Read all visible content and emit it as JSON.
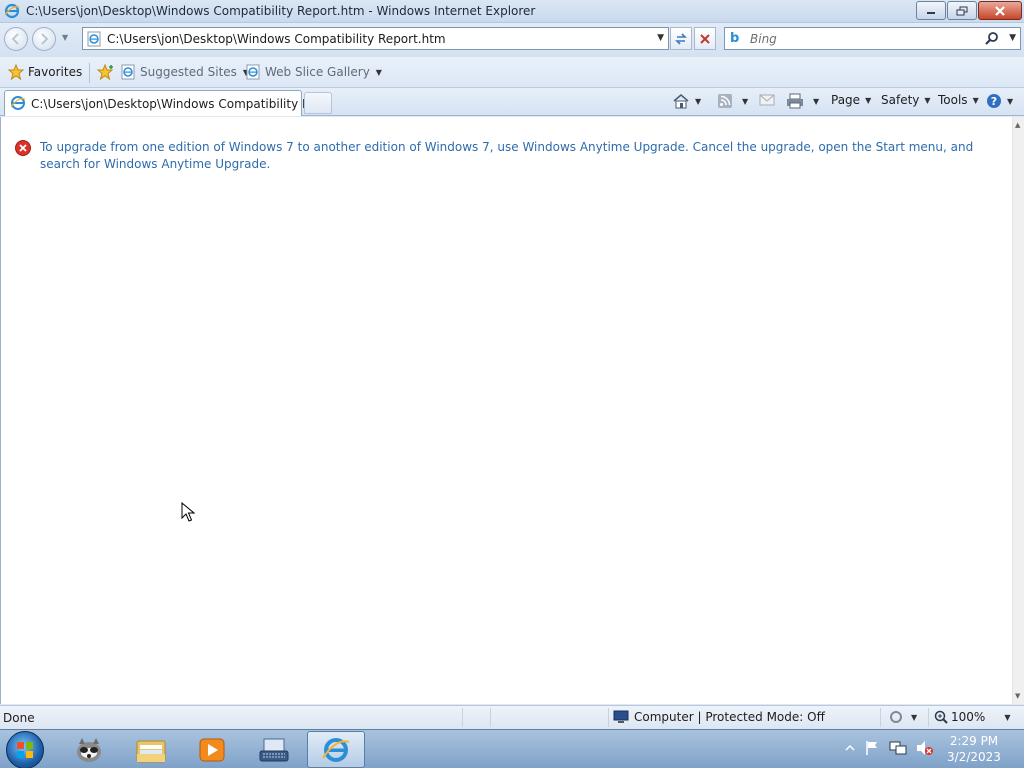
{
  "window": {
    "title": "C:\\Users\\jon\\Desktop\\Windows Compatibility Report.htm - Windows Internet Explorer"
  },
  "nav": {
    "address": "C:\\Users\\jon\\Desktop\\Windows Compatibility Report.htm",
    "search_placeholder": "Bing"
  },
  "favorites_bar": {
    "favorites_label": "Favorites",
    "suggested_sites_label": "Suggested Sites",
    "web_slice_gallery_label": "Web Slice Gallery"
  },
  "tab": {
    "title": "C:\\Users\\jon\\Desktop\\Windows Compatibility Re..."
  },
  "command_bar": {
    "page_label": "Page",
    "safety_label": "Safety",
    "tools_label": "Tools"
  },
  "content": {
    "message": "To upgrade from one edition of Windows 7 to another edition of Windows 7, use Windows Anytime Upgrade. Cancel the upgrade, open the Start menu, and search for Windows Anytime Upgrade."
  },
  "status_bar": {
    "status_text": "Done",
    "zone_text": "Computer | Protected Mode: Off",
    "zoom_text": "100%"
  },
  "taskbar": {
    "time": "2:29 PM",
    "date": "3/2/2023"
  },
  "colors": {
    "message_text": "#2e6cad",
    "error_icon": "#d9322b",
    "ie_blue": "#2a8fd6"
  }
}
